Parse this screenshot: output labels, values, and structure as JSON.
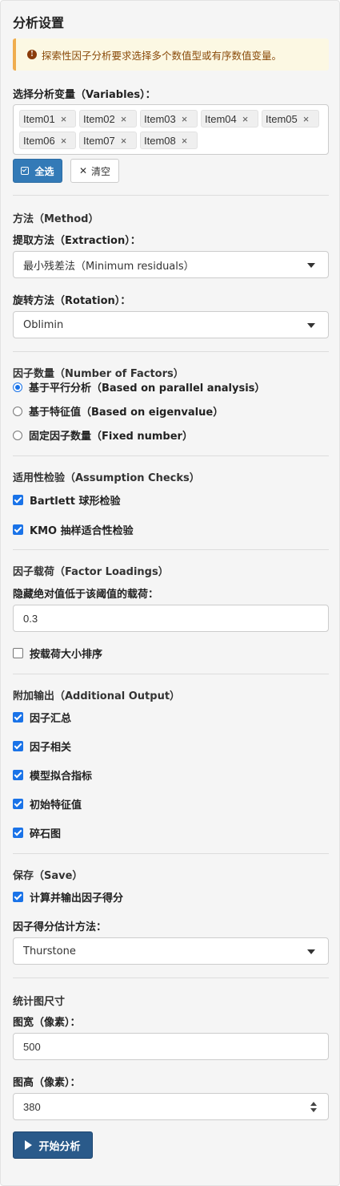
{
  "panel": {
    "title": "分析设置",
    "alert": "探索性因子分析要求选择多个数值型或有序数值变量。",
    "alert_icon": "exclamation-circle-icon"
  },
  "variables": {
    "label": "选择分析变量（Variables）：",
    "chips": [
      "Item01",
      "Item02",
      "Item03",
      "Item04",
      "Item05",
      "Item06",
      "Item07",
      "Item08"
    ],
    "remove_glyph": "×",
    "select_all": "全选",
    "clear": "清空"
  },
  "method": {
    "header": "方法（Method）",
    "extraction_label": "提取方法（Extraction）：",
    "extraction_value": "最小残差法（Minimum residuals）",
    "rotation_label": "旋转方法（Rotation）：",
    "rotation_value": "Oblimin"
  },
  "factors": {
    "header": "因子数量（Number of Factors）",
    "options": [
      {
        "label": "基于平行分析（Based on parallel analysis）",
        "selected": true
      },
      {
        "label": "基于特征值（Based on eigenvalue）",
        "selected": false
      },
      {
        "label": "固定因子数量（Fixed number）",
        "selected": false
      }
    ]
  },
  "assumption": {
    "header": "适用性检验（Assumption Checks）",
    "bartlett": "Bartlett 球形检验",
    "kmo": "KMO 抽样适合性检验"
  },
  "loadings": {
    "header": "因子载荷（Factor Loadings）",
    "hide_label": "隐藏绝对值低于该阈值的载荷：",
    "hide_value": "0.3",
    "sort_label": "按载荷大小排序"
  },
  "additional": {
    "header": "附加输出（Additional Output）",
    "items": [
      "因子汇总",
      "因子相关",
      "模型拟合指标",
      "初始特征值",
      "碎石图"
    ]
  },
  "save": {
    "header": "保存（Save）",
    "compute_scores": "计算并输出因子得分",
    "method_label": "因子得分估计方法：",
    "method_value": "Thurstone"
  },
  "plot": {
    "header": "统计图尺寸",
    "width_label": "图宽（像素）：",
    "width_value": "500",
    "height_label": "图高（像素）：",
    "height_value": "380"
  },
  "run_label": "开始分析",
  "colors": {
    "primary": "#337ab7",
    "run": "#2a5a8a",
    "check": "#1a73e8",
    "alert_bg": "#fcf8e3",
    "alert_border": "#f0ad4e"
  }
}
